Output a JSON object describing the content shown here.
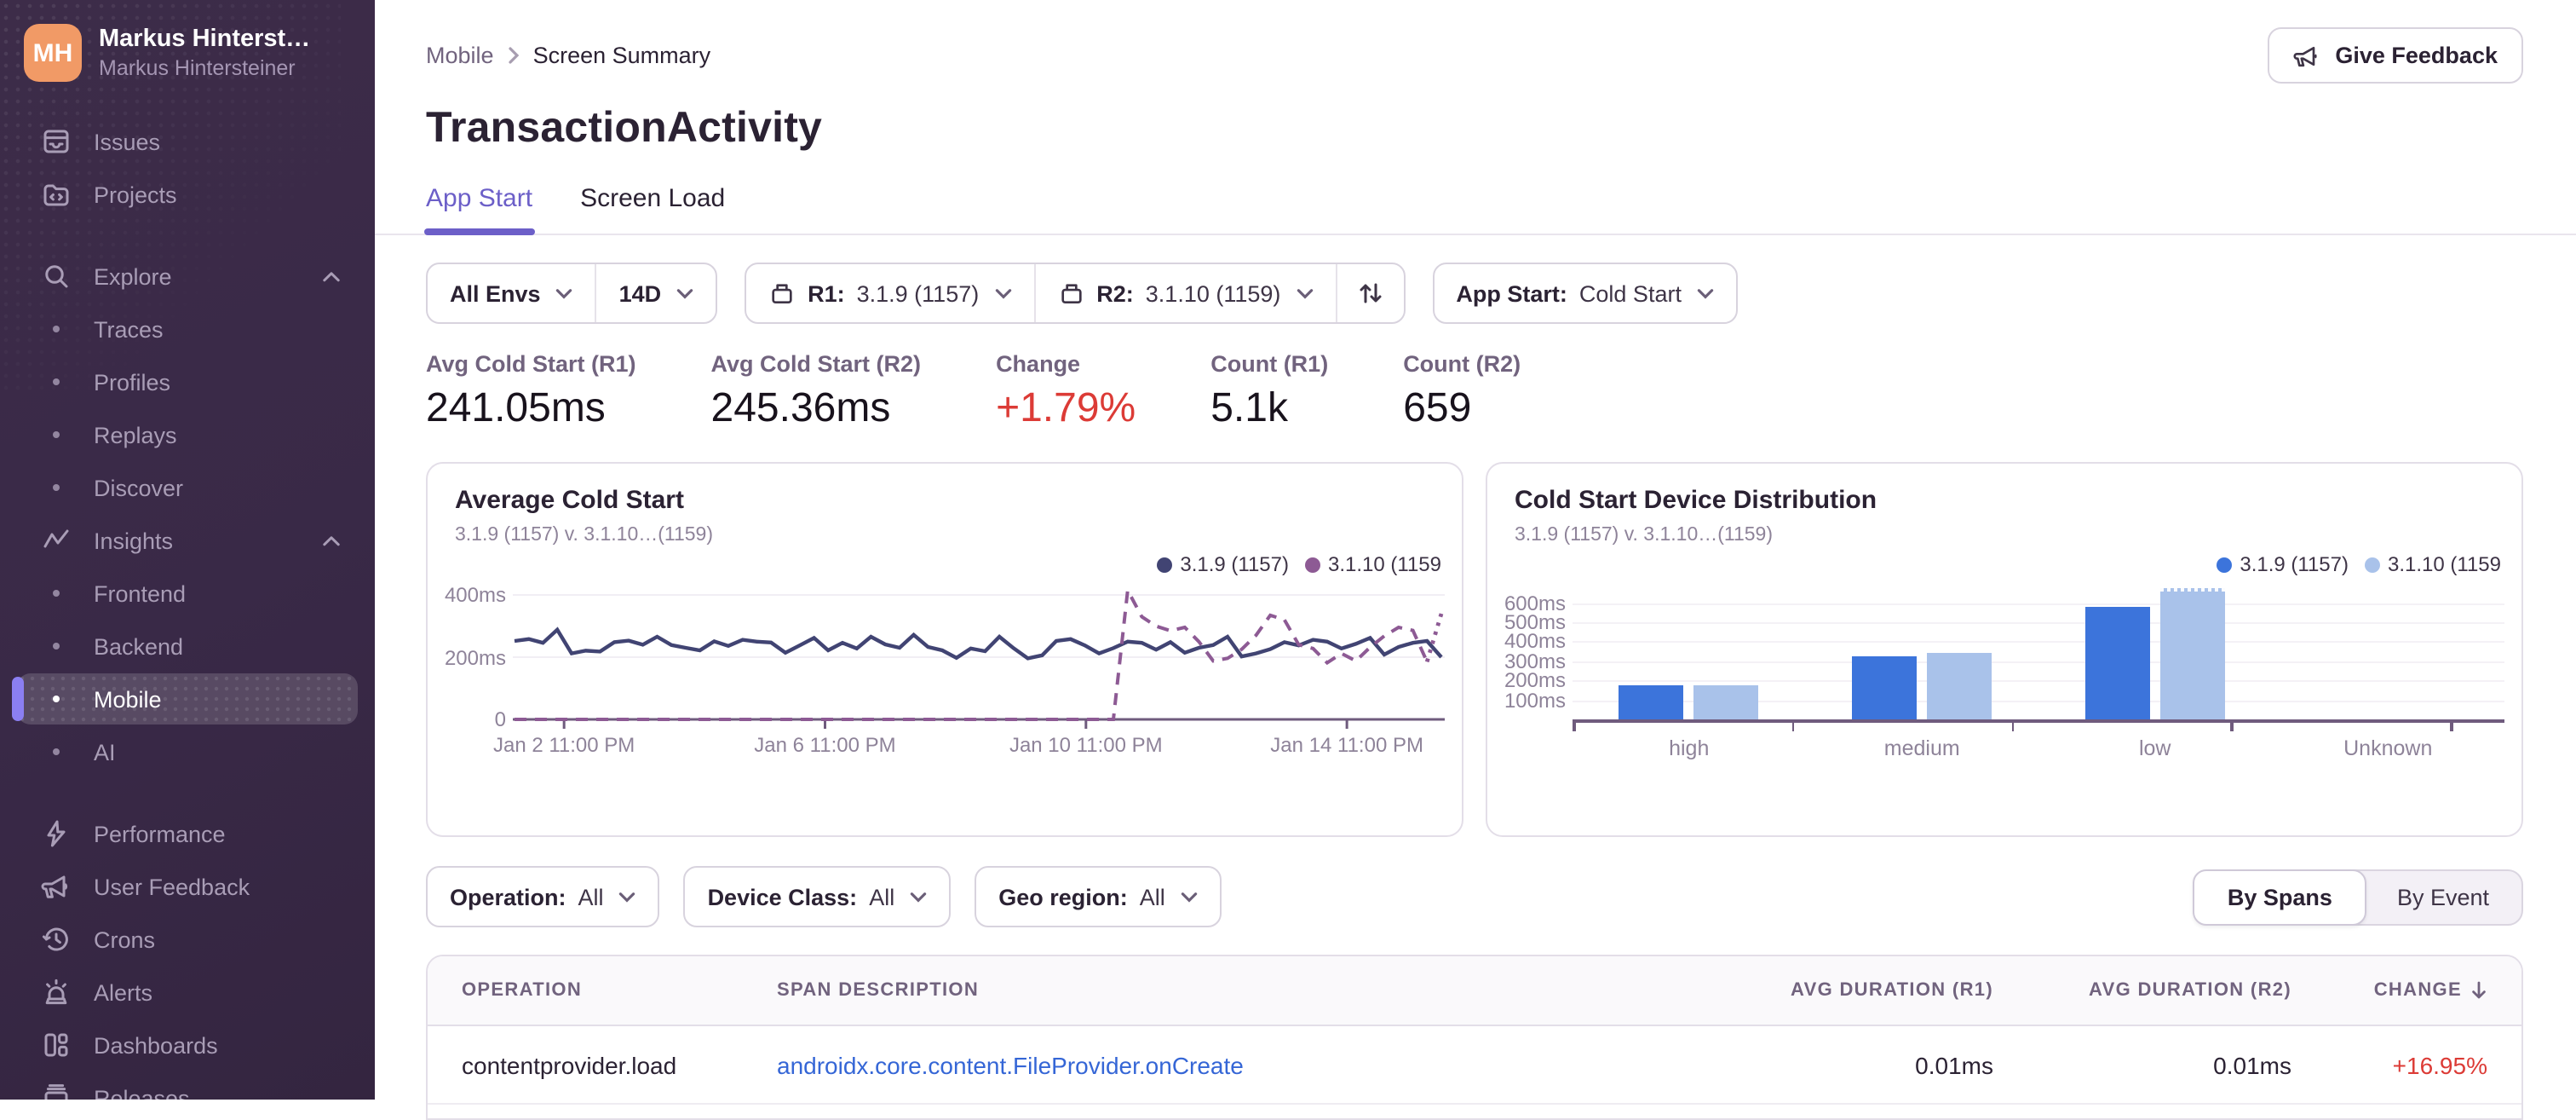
{
  "sidebar": {
    "user": {
      "initials": "MH",
      "name": "Markus Hinterst…",
      "org": "Markus Hintersteiner"
    },
    "items": [
      {
        "type": "link",
        "label": "Issues",
        "icon": "issues-icon"
      },
      {
        "type": "link",
        "label": "Projects",
        "icon": "projects-icon"
      },
      {
        "type": "spacer"
      },
      {
        "type": "group",
        "label": "Explore",
        "icon": "search-icon",
        "chevron": "up"
      },
      {
        "type": "sub",
        "label": "Traces"
      },
      {
        "type": "sub",
        "label": "Profiles"
      },
      {
        "type": "sub",
        "label": "Replays"
      },
      {
        "type": "sub",
        "label": "Discover"
      },
      {
        "type": "group",
        "label": "Insights",
        "icon": "insights-icon",
        "chevron": "up"
      },
      {
        "type": "sub",
        "label": "Frontend"
      },
      {
        "type": "sub",
        "label": "Backend"
      },
      {
        "type": "sub",
        "label": "Mobile",
        "selected": true
      },
      {
        "type": "sub",
        "label": "AI"
      },
      {
        "type": "spacer"
      },
      {
        "type": "link",
        "label": "Performance",
        "icon": "performance-icon"
      },
      {
        "type": "link",
        "label": "User Feedback",
        "icon": "megaphone-icon"
      },
      {
        "type": "link",
        "label": "Crons",
        "icon": "crons-icon"
      },
      {
        "type": "link",
        "label": "Alerts",
        "icon": "alerts-icon"
      },
      {
        "type": "link",
        "label": "Dashboards",
        "icon": "dashboards-icon"
      },
      {
        "type": "link",
        "label": "Releases",
        "icon": "releases-icon"
      }
    ]
  },
  "header": {
    "breadcrumb": [
      "Mobile",
      "Screen Summary"
    ],
    "title": "TransactionActivity",
    "feedback_button": "Give Feedback",
    "tabs": [
      {
        "label": "App Start",
        "active": true
      },
      {
        "label": "Screen Load",
        "active": false
      }
    ]
  },
  "filters": {
    "env": "All Envs",
    "date_range": "14D",
    "release1": {
      "label": "R1:",
      "value": "3.1.9 (1157)"
    },
    "release2": {
      "label": "R2:",
      "value": "3.1.10 (1159)"
    },
    "app_start": {
      "label": "App Start:",
      "value": "Cold Start"
    }
  },
  "stats": [
    {
      "label": "Avg Cold Start (R1)",
      "value": "241.05ms",
      "color": "#18121C"
    },
    {
      "label": "Avg Cold Start (R2)",
      "value": "245.36ms",
      "color": "#18121C"
    },
    {
      "label": "Change",
      "value": "+1.79%",
      "color": "#DC3B36"
    },
    {
      "label": "Count (R1)",
      "value": "5.1k",
      "color": "#18121C"
    },
    {
      "label": "Count (R2)",
      "value": "659",
      "color": "#18121C"
    }
  ],
  "span_filters": {
    "operation": {
      "label": "Operation:",
      "value": "All"
    },
    "device_class": {
      "label": "Device Class:",
      "value": "All"
    },
    "geo_region": {
      "label": "Geo region:",
      "value": "All"
    }
  },
  "view_toggle": {
    "options": [
      {
        "label": "By Spans",
        "active": true
      },
      {
        "label": "By Event",
        "active": false
      }
    ]
  },
  "table": {
    "columns": [
      "OPERATION",
      "SPAN DESCRIPTION",
      "AVG DURATION (R1)",
      "AVG DURATION (R2)",
      "CHANGE"
    ],
    "sorted_column": "CHANGE",
    "link_color": "#3566D6",
    "rows": [
      {
        "operation": "contentprovider.load",
        "span_description": "androidx.core.content.FileProvider.onCreate",
        "avg_r1": "0.01ms",
        "avg_r2": "0.01ms",
        "change": "+16.95%",
        "change_color": "#DC3B36"
      }
    ]
  },
  "chart_data": [
    {
      "type": "line",
      "title": "Average Cold Start",
      "subtitle": "3.1.9 (1157) v. 3.1.10…(1159)",
      "ylim": [
        0,
        460
      ],
      "yticks": [
        {
          "value": 0,
          "label": "0"
        },
        {
          "value": 200,
          "label": "200ms"
        },
        {
          "value": 400,
          "label": "400ms"
        }
      ],
      "xticks": [
        {
          "frac": 0.055,
          "label": "Jan 2 11:00 PM"
        },
        {
          "frac": 0.335,
          "label": "Jan 6 11:00 PM"
        },
        {
          "frac": 0.615,
          "label": "Jan 10 11:00 PM"
        },
        {
          "frac": 0.895,
          "label": "Jan 14 11:00 PM"
        }
      ],
      "legend_position": "top-right",
      "grid": true,
      "series": [
        {
          "name": "3.1.9 (1157)",
          "color": "#414473",
          "style": "solid",
          "values": [
            252,
            258,
            246,
            288,
            212,
            221,
            218,
            248,
            253,
            240,
            266,
            239,
            230,
            222,
            251,
            236,
            256,
            250,
            247,
            214,
            238,
            262,
            222,
            246,
            228,
            266,
            241,
            230,
            272,
            233,
            222,
            198,
            228,
            219,
            266,
            229,
            196,
            206,
            252,
            258,
            238,
            212,
            229,
            250,
            246,
            224,
            248,
            214,
            230,
            239,
            266,
            202,
            212,
            226,
            248,
            238,
            256,
            250,
            228,
            243,
            262,
            208,
            233,
            246,
            252,
            200
          ]
        },
        {
          "name": "3.1.10 (1159",
          "color": "#8D5A94",
          "style": "dashed",
          "dotted_tail_points": 2,
          "values": [
            0,
            0,
            0,
            0,
            0,
            0,
            0,
            0,
            0,
            0,
            0,
            0,
            0,
            0,
            0,
            0,
            0,
            0,
            0,
            0,
            0,
            0,
            0,
            0,
            0,
            0,
            0,
            0,
            0,
            0,
            0,
            0,
            0,
            0,
            0,
            0,
            0,
            0,
            0,
            0,
            0,
            0,
            0,
            415,
            330,
            300,
            285,
            296,
            250,
            188,
            196,
            225,
            270,
            335,
            320,
            240,
            228,
            182,
            212,
            188,
            232,
            268,
            296,
            286,
            185,
            340
          ]
        }
      ]
    },
    {
      "type": "bar",
      "title": "Cold Start Device Distribution",
      "subtitle": "3.1.9 (1157) v. 3.1.10…(1159)",
      "categories": [
        "high",
        "medium",
        "low",
        "Unknown"
      ],
      "yticks": [
        100,
        200,
        300,
        400,
        500,
        600
      ],
      "ytick_unit": "ms",
      "ylim": [
        0,
        680
      ],
      "legend_position": "top-right",
      "grid": true,
      "series": [
        {
          "name": "3.1.9 (1157)",
          "color": "#3C74DB",
          "values": [
            175,
            325,
            580,
            0
          ]
        },
        {
          "name": "3.1.10 (1159",
          "color": "#A9C2EA",
          "values": [
            172,
            338,
            660,
            0
          ],
          "dotted_top_index": 2
        }
      ]
    }
  ]
}
